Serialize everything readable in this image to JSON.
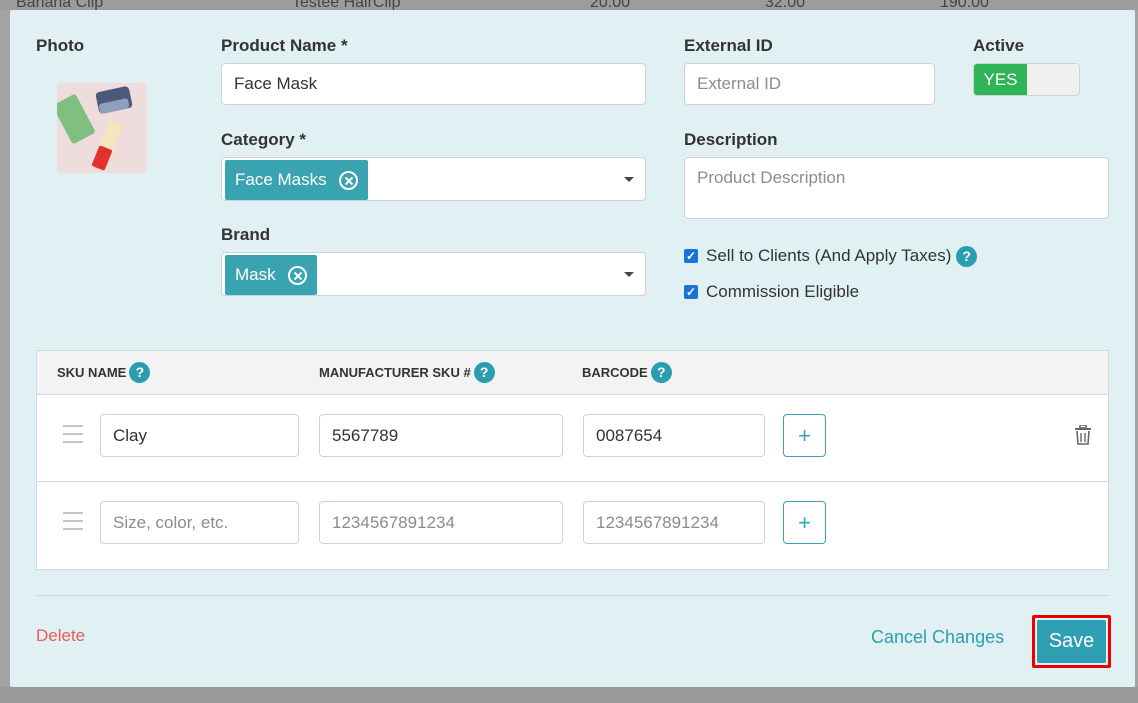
{
  "background": {
    "row_cells": [
      "Banana Clip",
      "Testee HairClip",
      "20.00",
      "32.00",
      "190.00"
    ]
  },
  "photo": {
    "label": "Photo"
  },
  "product_name": {
    "label": "Product Name *",
    "value": "Face Mask"
  },
  "external_id": {
    "label": "External ID",
    "placeholder": "External ID"
  },
  "active": {
    "label": "Active",
    "toggle_label": "YES"
  },
  "category": {
    "label": "Category *",
    "tag": "Face Masks"
  },
  "description": {
    "label": "Description",
    "placeholder": "Product Description"
  },
  "brand": {
    "label": "Brand",
    "tag": "Mask"
  },
  "options": {
    "sell_to_clients": "Sell to Clients (And Apply Taxes)",
    "commission_eligible": "Commission Eligible"
  },
  "sku_table": {
    "headers": {
      "sku_name": "SKU NAME",
      "manufacturer_sku": "MANUFACTURER SKU #",
      "barcode": "BARCODE"
    },
    "help_glyph": "?",
    "add_glyph": "+",
    "rows": [
      {
        "sku_name": "Clay",
        "manufacturer_sku": "5567789",
        "barcode": "0087654"
      },
      {
        "sku_name_placeholder": "Size, color, etc.",
        "manufacturer_sku_placeholder": "1234567891234",
        "barcode_placeholder": "1234567891234"
      }
    ]
  },
  "footer": {
    "delete_label": "Delete",
    "cancel_label": "Cancel Changes",
    "save_label": "Save"
  },
  "colors": {
    "modal_bg": "#e1f0f2",
    "accent": "#3aa3b2",
    "active_green": "#2fb457",
    "delete_red": "#e45c5c",
    "highlight_border": "#ee0000"
  }
}
